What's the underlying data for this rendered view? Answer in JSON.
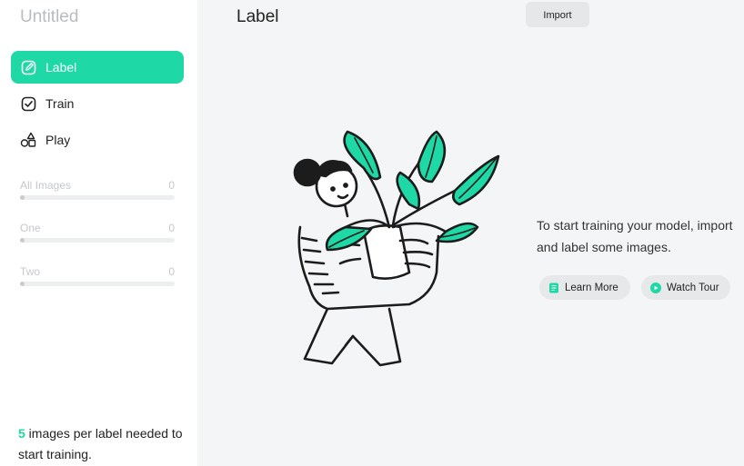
{
  "sidebar": {
    "project_title": "Untitled",
    "nav": [
      {
        "label": "Label",
        "icon": "edit-icon",
        "active": true
      },
      {
        "label": "Train",
        "icon": "check-square-icon",
        "active": false
      },
      {
        "label": "Play",
        "icon": "shapes-icon",
        "active": false
      }
    ],
    "labels": [
      {
        "name": "All Images",
        "count": "0"
      },
      {
        "name": "One",
        "count": "0"
      },
      {
        "name": "Two",
        "count": "0"
      }
    ],
    "hint": {
      "number": "5",
      "text": " images per label needed to start training."
    }
  },
  "header": {
    "title": "Label",
    "import_label": "Import"
  },
  "empty_state": {
    "illustration": "person-holding-plant",
    "message": "To start training your model, import and label some images.",
    "learn_more_label": "Learn More",
    "learn_more_icon": "document-icon",
    "watch_tour_label": "Watch Tour",
    "watch_tour_icon": "play-circle-icon"
  },
  "colors": {
    "accent": "#1ed8a6",
    "sidebar_bg": "#ffffff",
    "main_bg": "#f4f5f6",
    "muted_text": "#c5c8cc"
  }
}
